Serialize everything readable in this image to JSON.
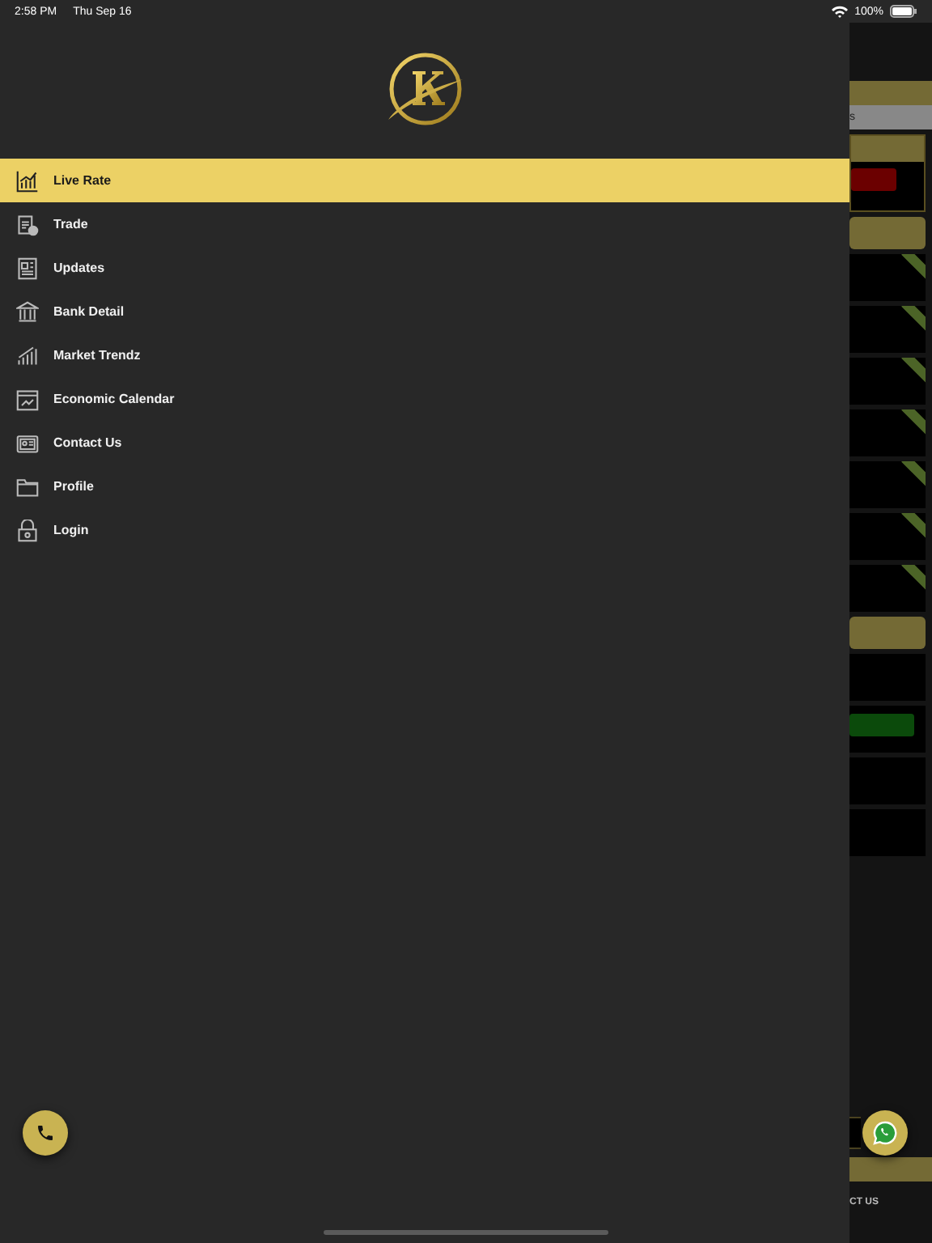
{
  "status_bar": {
    "time": "2:58 PM",
    "date": "Thu Sep 16",
    "battery": "100%"
  },
  "menu": {
    "items": [
      {
        "label": "Live Rate",
        "selected": true
      },
      {
        "label": "Trade",
        "selected": false
      },
      {
        "label": "Updates",
        "selected": false
      },
      {
        "label": "Bank Detail",
        "selected": false
      },
      {
        "label": "Market Trendz",
        "selected": false
      },
      {
        "label": "Economic Calendar",
        "selected": false
      },
      {
        "label": "Contact Us",
        "selected": false
      },
      {
        "label": "Profile",
        "selected": false
      },
      {
        "label": "Login",
        "selected": false
      }
    ]
  },
  "background_app": {
    "tab_text": "s",
    "footer_text": "CT US"
  }
}
